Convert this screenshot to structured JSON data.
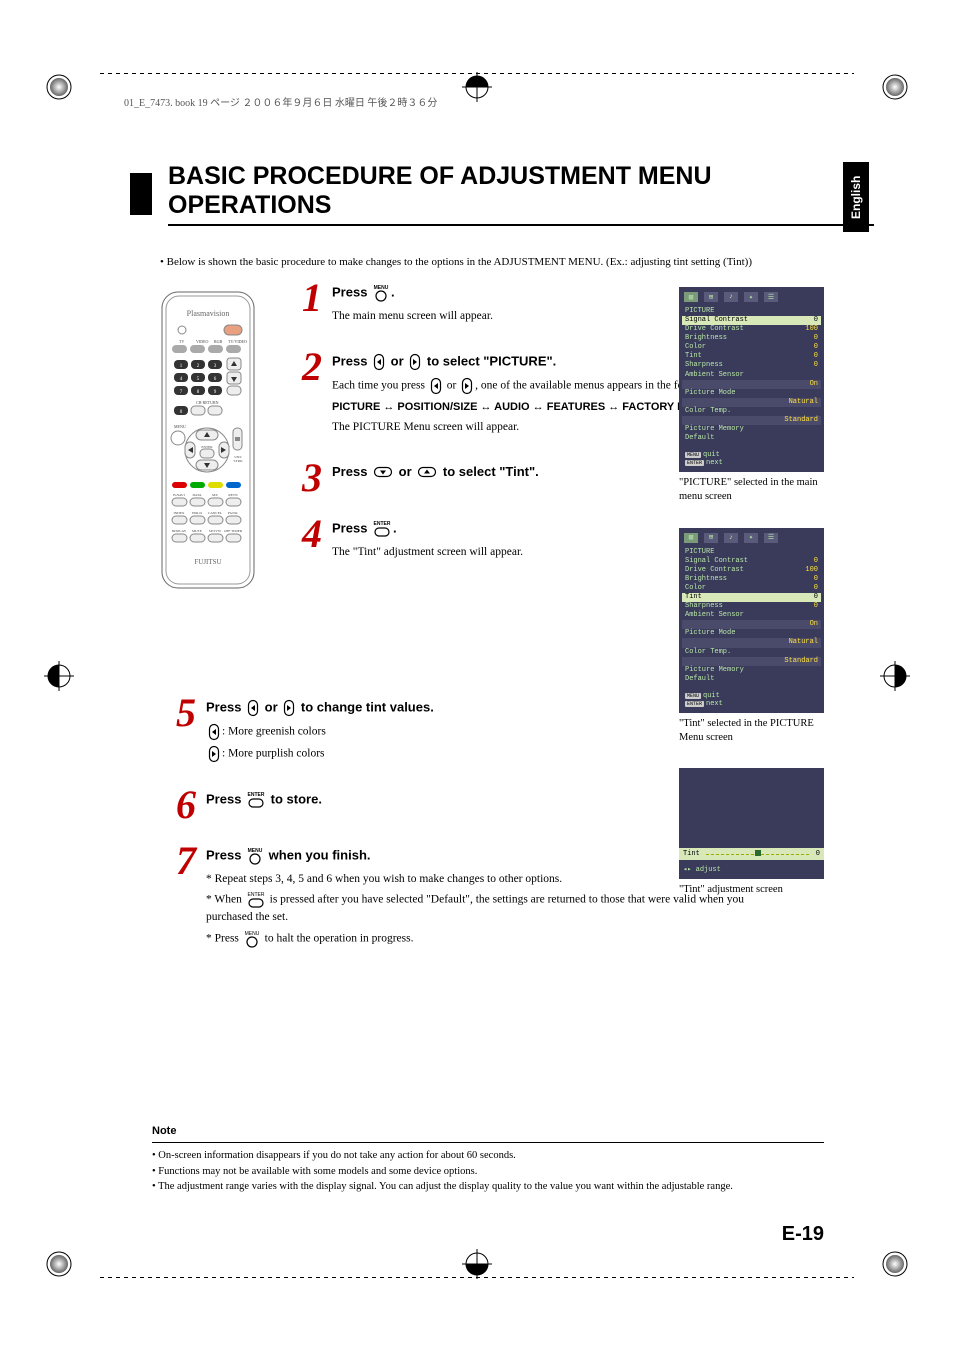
{
  "header_text": "01_E_7473. book 19 ページ ２００６年９月６日 水曜日 午後２時３６分",
  "page_title": "BASIC PROCEDURE OF ADJUSTMENT MENU OPERATIONS",
  "lang": "English",
  "intro": "• Below is shown the basic procedure to make changes to the options in the ADJUSTMENT MENU. (Ex.: adjusting tint setting (Tint))",
  "remote_brand": "Plasmavision",
  "remote_maker": "FUJITSU",
  "icon_menu_label": "MENU",
  "icon_enter_label": "ENTER",
  "steps": [
    {
      "num": "1",
      "head_a": "Press ",
      "head_b": ".",
      "icon": "menu",
      "body": [
        "The main menu screen will appear."
      ],
      "bold": []
    },
    {
      "num": "2",
      "head_a": "Press ",
      "head_mid": " or ",
      "head_b": " to select \"PICTURE\".",
      "icon": "leftright",
      "body": [
        "Each time you press ",
        " one of the available menus appears in the following sequence:"
      ],
      "bold": [
        "PICTURE ↔ POSITION/SIZE ↔ AUDIO ↔ FEATURES ↔ FACTORY DEFAULT"
      ],
      "body2": [
        "The PICTURE Menu screen will appear."
      ]
    },
    {
      "num": "3",
      "head_a": "Press ",
      "head_mid": " or ",
      "head_b": " to select \"Tint\".",
      "icon": "updown"
    },
    {
      "num": "4",
      "head_a": "Press ",
      "head_b": ".",
      "icon": "enter",
      "body": [
        "The \"Tint\" adjustment screen will appear."
      ]
    },
    {
      "num": "5",
      "head_a": "Press ",
      "head_mid": " or ",
      "head_b": " to change tint values.",
      "icon": "leftright",
      "rows": [
        {
          "icon": "left",
          "text": ": More greenish colors"
        },
        {
          "icon": "right",
          "text": ": More purplish colors"
        }
      ]
    },
    {
      "num": "6",
      "head_a": "Press ",
      "head_b": " to store.",
      "icon": "enter"
    },
    {
      "num": "7",
      "head_a": "Press ",
      "head_b": " when you finish.",
      "icon": "menu",
      "list": [
        "* Repeat steps 3, 4, 5 and 6 when you wish to make changes to other options.",
        "* When      is pressed after you have selected \"Default\", the settings are returned to those that were valid when you purchased the set.",
        "* Press     to halt the operation in progress."
      ]
    }
  ],
  "osd": {
    "title": "PICTURE",
    "rows": [
      {
        "label": "Signal Contrast",
        "value": "0"
      },
      {
        "label": "Drive Contrast",
        "value": "100"
      },
      {
        "label": "Brightness",
        "value": "0"
      },
      {
        "label": "Color",
        "value": "0"
      },
      {
        "label": "Tint",
        "value": "0"
      },
      {
        "label": "Sharpness",
        "value": "0"
      },
      {
        "label": "Ambient Sensor",
        "value": ""
      },
      {
        "label": "",
        "value": "On"
      },
      {
        "label": "Picture Mode",
        "value": ""
      },
      {
        "label": "",
        "value": "Natural"
      },
      {
        "label": "Color Temp.",
        "value": ""
      },
      {
        "label": "",
        "value": "Standard"
      },
      {
        "label": "Picture Memory",
        "value": ""
      },
      {
        "label": "Default",
        "value": ""
      }
    ],
    "action_quit": "quit",
    "action_next": "next"
  },
  "caption1": "\"PICTURE\" selected in the main menu screen",
  "caption2": "\"Tint\" selected in the PICTURE Menu screen",
  "caption3": "\"Tint\" adjustment screen",
  "tint_screen": {
    "label": "Tint",
    "value": "0",
    "adjust": "◂▸ adjust"
  },
  "notes": {
    "title": "Note",
    "items": [
      "• On-screen information disappears if you do not take any action for about 60 seconds.",
      "• Functions may not be available with some models and some device options.",
      "• The adjustment range varies with the display signal. You can adjust the display quality to the value you want within the adjustable range."
    ]
  },
  "page_number": "E-19",
  "lr_text": "or"
}
